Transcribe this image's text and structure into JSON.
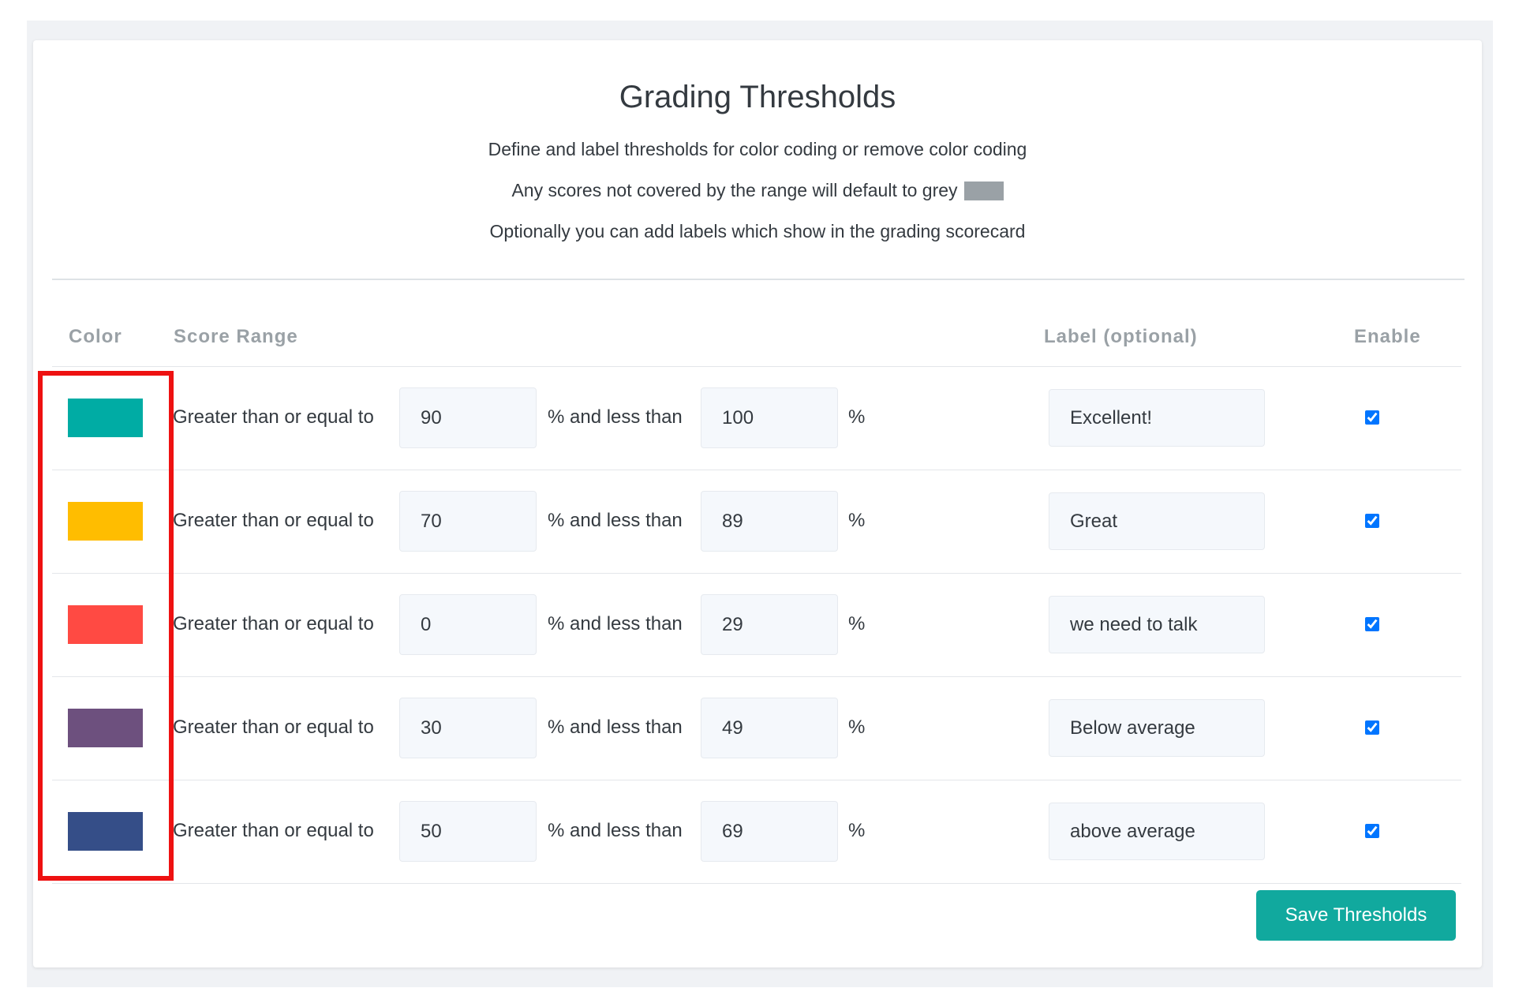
{
  "header": {
    "title": "Grading Thresholds",
    "description_1": "Define and label thresholds for color coding or remove color coding",
    "description_2": "Any scores not covered by the range will default to grey",
    "description_3": "Optionally you can add labels which show in the grading scorecard",
    "default_grey_color": "#9aa1a6"
  },
  "table": {
    "columns": {
      "color": "Color",
      "score_range": "Score Range",
      "label": "Label (optional)",
      "enable": "Enable"
    },
    "text": {
      "gte": "Greater than or equal to",
      "and_less_than": "% and less than",
      "percent": "%"
    },
    "rows": [
      {
        "color": "#00aca4",
        "min": "90",
        "max": "100",
        "label": "Excellent!",
        "enabled": true
      },
      {
        "color": "#ffbd00",
        "min": "70",
        "max": "89",
        "label": "Great",
        "enabled": true
      },
      {
        "color": "#ff4a43",
        "min": "0",
        "max": "29",
        "label": "we need to talk",
        "enabled": true
      },
      {
        "color": "#6d507e",
        "min": "30",
        "max": "49",
        "label": "Below average",
        "enabled": true
      },
      {
        "color": "#354e88",
        "min": "50",
        "max": "69",
        "label": "above average",
        "enabled": true
      }
    ]
  },
  "actions": {
    "save_label": "Save Thresholds",
    "save_color": "#11a99e"
  },
  "annotation": {
    "highlight_color": "#ee1111"
  }
}
